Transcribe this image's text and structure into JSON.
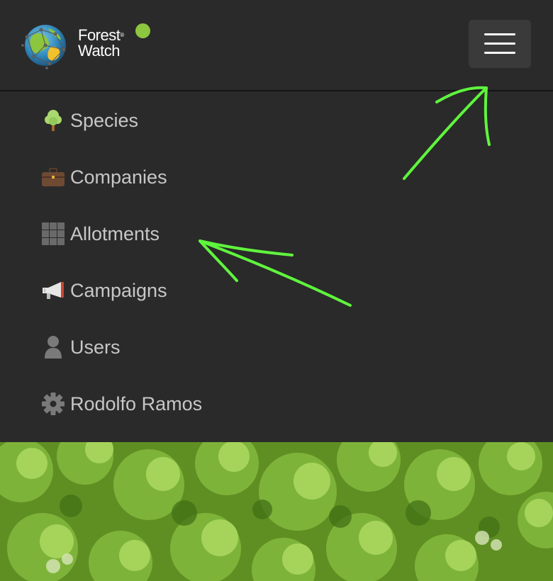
{
  "header": {
    "logo_line1": "Forest",
    "logo_line2": "Watch",
    "logo_mark": "®",
    "status_color": "#8dc63f",
    "menu_button_icon": "hamburger-icon"
  },
  "menu": {
    "items": [
      {
        "label": "Species",
        "icon": "tree-icon"
      },
      {
        "label": "Companies",
        "icon": "briefcase-icon"
      },
      {
        "label": "Allotments",
        "icon": "grid-icon"
      },
      {
        "label": "Campaigns",
        "icon": "megaphone-icon"
      },
      {
        "label": "Users",
        "icon": "user-icon"
      },
      {
        "label": "Rodolfo Ramos",
        "icon": "gear-icon"
      }
    ]
  },
  "colors": {
    "background": "#2a2a2a",
    "menu_text": "#c7c7c7",
    "annotation": "#5ff53d"
  }
}
